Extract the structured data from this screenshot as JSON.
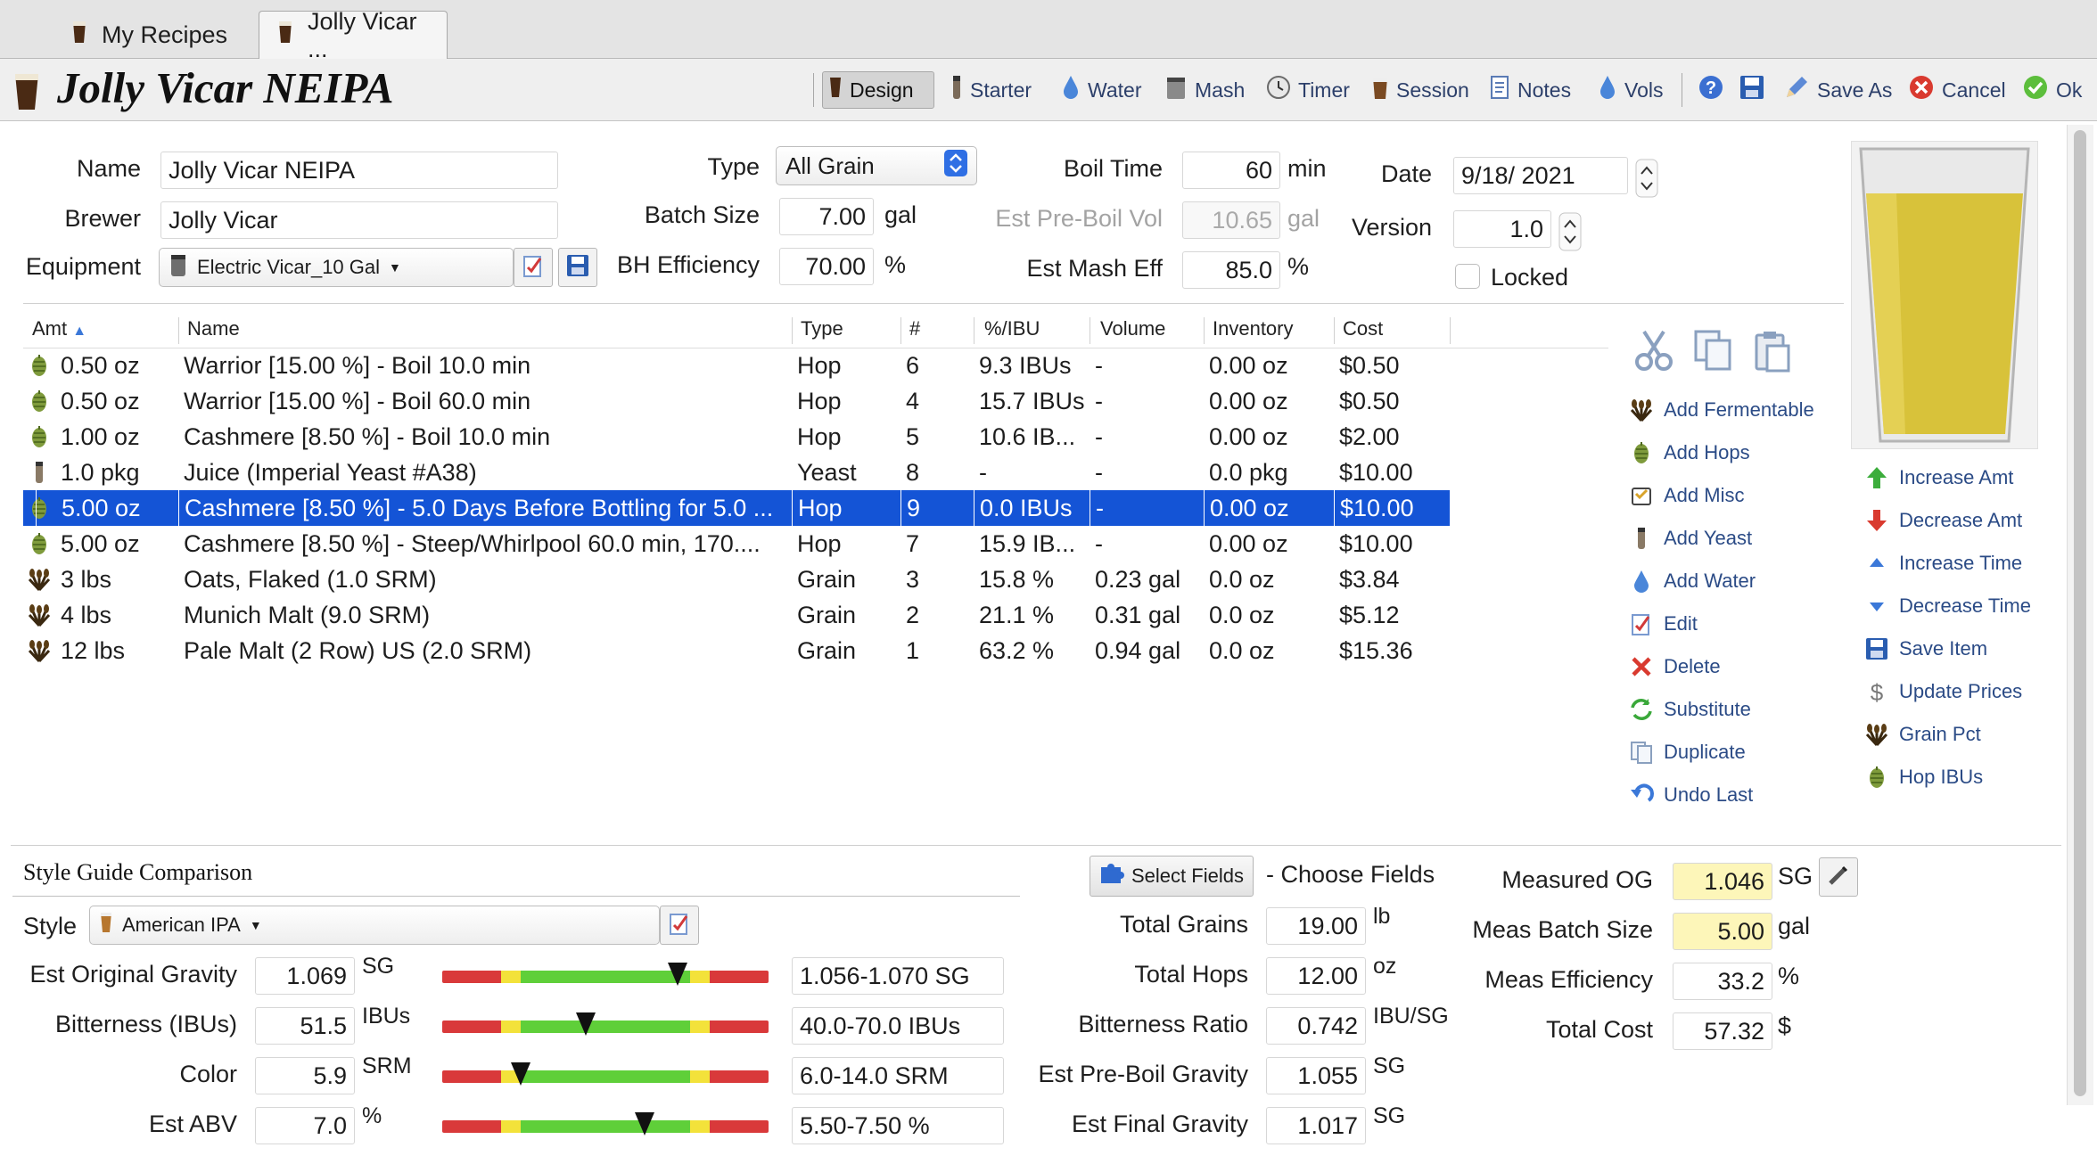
{
  "tabs": [
    {
      "label": "My Recipes"
    },
    {
      "label": "Jolly Vicar ..."
    }
  ],
  "title": "Jolly Vicar NEIPA",
  "toolbar": {
    "design": "Design",
    "starter": "Starter",
    "water": "Water",
    "mash": "Mash",
    "timer": "Timer",
    "session": "Session",
    "notes": "Notes",
    "vols": "Vols",
    "save_as": "Save As",
    "cancel": "Cancel",
    "ok": "Ok"
  },
  "form": {
    "name_label": "Name",
    "name_value": "Jolly Vicar NEIPA",
    "brewer_label": "Brewer",
    "brewer_value": "Jolly Vicar",
    "equipment_label": "Equipment",
    "equipment_value": "Electric Vicar_10 Gal",
    "type_label": "Type",
    "type_value": "All Grain",
    "batch_size_label": "Batch Size",
    "batch_size_value": "7.00",
    "batch_size_unit": "gal",
    "bh_eff_label": "BH Efficiency",
    "bh_eff_value": "70.00",
    "bh_eff_unit": "%",
    "boil_time_label": "Boil Time",
    "boil_time_value": "60",
    "boil_time_unit": "min",
    "pre_boil_label": "Est Pre-Boil Vol",
    "pre_boil_value": "10.65",
    "pre_boil_unit": "gal",
    "mash_eff_label": "Est Mash Eff",
    "mash_eff_value": "85.0",
    "mash_eff_unit": "%",
    "date_label": "Date",
    "date_value": "9/18/ 2021",
    "version_label": "Version",
    "version_value": "1.0",
    "locked_label": "Locked"
  },
  "table": {
    "headers": [
      "Amt",
      "Name",
      "Type",
      "#",
      "%/IBU",
      "Volume",
      "Inventory",
      "Cost"
    ],
    "rows": [
      {
        "icon": "hop",
        "amt": "0.50 oz",
        "name": "Warrior [15.00 %] - Boil 10.0 min",
        "type": "Hop",
        "num": "6",
        "pct": "9.3 IBUs",
        "vol": "-",
        "inv": "0.00 oz",
        "cost": "$0.50"
      },
      {
        "icon": "hop",
        "amt": "0.50 oz",
        "name": "Warrior [15.00 %] - Boil 60.0 min",
        "type": "Hop",
        "num": "4",
        "pct": "15.7 IBUs",
        "vol": "-",
        "inv": "0.00 oz",
        "cost": "$0.50"
      },
      {
        "icon": "hop",
        "amt": "1.00 oz",
        "name": "Cashmere [8.50 %] - Boil 10.0 min",
        "type": "Hop",
        "num": "5",
        "pct": "10.6 IB...",
        "vol": "-",
        "inv": "0.00 oz",
        "cost": "$2.00"
      },
      {
        "icon": "yeast",
        "amt": "1.0 pkg",
        "name": "Juice (Imperial Yeast #A38)",
        "type": "Yeast",
        "num": "8",
        "pct": "-",
        "vol": "-",
        "inv": "0.0 pkg",
        "cost": "$10.00"
      },
      {
        "icon": "hop",
        "amt": "5.00 oz",
        "name": "Cashmere [8.50 %] - 5.0 Days Before Bottling for 5.0 ...",
        "type": "Hop",
        "num": "9",
        "pct": "0.0 IBUs",
        "vol": "-",
        "inv": "0.00 oz",
        "cost": "$10.00",
        "selected": true
      },
      {
        "icon": "hop",
        "amt": "5.00 oz",
        "name": "Cashmere [8.50 %] - Steep/Whirlpool  60.0 min, 170....",
        "type": "Hop",
        "num": "7",
        "pct": "15.9 IB...",
        "vol": "-",
        "inv": "0.00 oz",
        "cost": "$10.00"
      },
      {
        "icon": "grain",
        "amt": "3 lbs",
        "name": "Oats, Flaked (1.0 SRM)",
        "type": "Grain",
        "num": "3",
        "pct": "15.8 %",
        "vol": "0.23 gal",
        "inv": "0.0 oz",
        "cost": "$3.84"
      },
      {
        "icon": "grain",
        "amt": "4 lbs",
        "name": "Munich Malt (9.0 SRM)",
        "type": "Grain",
        "num": "2",
        "pct": "21.1 %",
        "vol": "0.31 gal",
        "inv": "0.0 oz",
        "cost": "$5.12"
      },
      {
        "icon": "grain",
        "amt": "12 lbs",
        "name": "Pale Malt (2 Row) US (2.0 SRM)",
        "type": "Grain",
        "num": "1",
        "pct": "63.2 %",
        "vol": "0.94 gal",
        "inv": "0.0 oz",
        "cost": "$15.36"
      }
    ]
  },
  "actions_left": [
    {
      "icon": "grain",
      "label": "Add Fermentable"
    },
    {
      "icon": "hop",
      "label": "Add Hops"
    },
    {
      "icon": "misc",
      "label": "Add Misc"
    },
    {
      "icon": "yeast",
      "label": "Add Yeast"
    },
    {
      "icon": "water",
      "label": "Add Water"
    },
    {
      "icon": "edit",
      "label": "Edit"
    },
    {
      "icon": "delete",
      "label": "Delete"
    },
    {
      "icon": "substitute",
      "label": "Substitute"
    },
    {
      "icon": "duplicate",
      "label": "Duplicate"
    },
    {
      "icon": "undo",
      "label": "Undo Last"
    }
  ],
  "actions_right": [
    {
      "icon": "up-arrow",
      "label": "Increase Amt"
    },
    {
      "icon": "down-arrow",
      "label": "Decrease Amt"
    },
    {
      "icon": "up-small",
      "label": "Increase Time"
    },
    {
      "icon": "down-small",
      "label": "Decrease Time"
    },
    {
      "icon": "save",
      "label": "Save Item"
    },
    {
      "icon": "dollar",
      "label": "Update Prices"
    },
    {
      "icon": "grain",
      "label": "Grain Pct"
    },
    {
      "icon": "hop",
      "label": "Hop IBUs"
    }
  ],
  "style_guide": {
    "section_title": "Style Guide Comparison",
    "style_label": "Style",
    "style_value": "American IPA",
    "rows": [
      {
        "label": "Est Original Gravity",
        "value": "1.069",
        "unit": "SG",
        "range": "1.056-1.070 SG",
        "marker": 0.72
      },
      {
        "label": "Bitterness (IBUs)",
        "value": "51.5",
        "unit": "IBUs",
        "range": "40.0-70.0 IBUs",
        "marker": 0.44
      },
      {
        "label": "Color",
        "value": "5.9",
        "unit": "SRM",
        "range": "6.0-14.0 SRM",
        "marker": 0.24
      },
      {
        "label": "Est ABV",
        "value": "7.0",
        "unit": "%",
        "range": "5.50-7.50 %",
        "marker": 0.62
      }
    ]
  },
  "fields": {
    "select_button": "Select Fields",
    "choose_label": "- Choose Fields",
    "rows": [
      {
        "label": "Total Grains",
        "value": "19.00",
        "unit": "lb"
      },
      {
        "label": "Total Hops",
        "value": "12.00",
        "unit": "oz"
      },
      {
        "label": "Bitterness Ratio",
        "value": "0.742",
        "unit": "IBU/SG"
      },
      {
        "label": "Est Pre-Boil Gravity",
        "value": "1.055",
        "unit": "SG"
      },
      {
        "label": "Est Final Gravity",
        "value": "1.017",
        "unit": "SG"
      }
    ]
  },
  "measured": {
    "rows": [
      {
        "label": "Measured OG",
        "value": "1.046",
        "unit": "SG",
        "highlight": true
      },
      {
        "label": "Meas Batch Size",
        "value": "5.00",
        "unit": "gal",
        "highlight": true
      },
      {
        "label": "Meas Efficiency",
        "value": "33.2",
        "unit": "%",
        "highlight": false
      },
      {
        "label": "Total Cost",
        "value": "57.32",
        "unit": "$",
        "highlight": false
      }
    ]
  },
  "colors": {
    "selection": "#1454d6",
    "beer": "#d8c23a",
    "link": "#2b4b86",
    "bar_red": "#d9393a",
    "bar_yellow": "#f3e23a",
    "bar_green": "#5fcf39"
  }
}
